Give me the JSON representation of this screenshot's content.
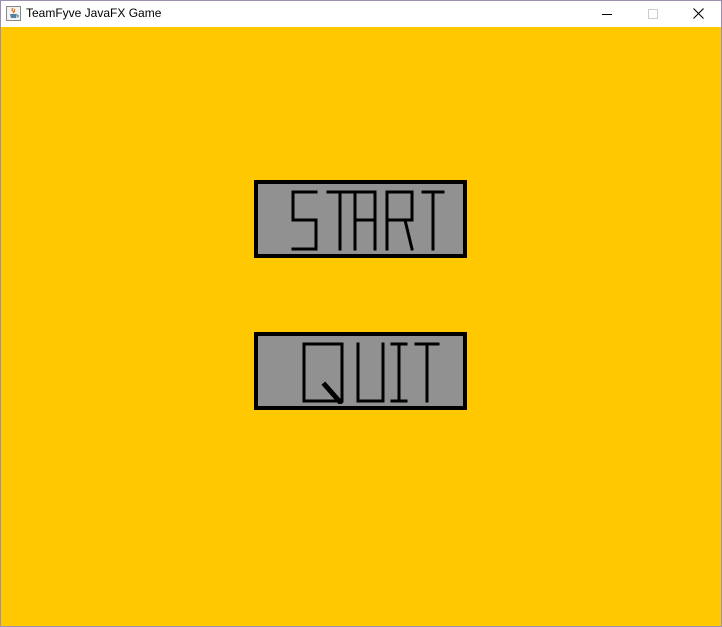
{
  "window": {
    "title": "TeamFyve JavaFX Game",
    "icons": {
      "app": "java-cup-icon",
      "minimize": "minimize-icon",
      "maximize": "maximize-icon",
      "close": "close-icon"
    }
  },
  "menu": {
    "background_color": "#ffc800",
    "button_fill": "#919191",
    "button_border": "#000000",
    "buttons": [
      {
        "id": "start",
        "label": "START"
      },
      {
        "id": "quit",
        "label": "QUIT"
      }
    ]
  }
}
